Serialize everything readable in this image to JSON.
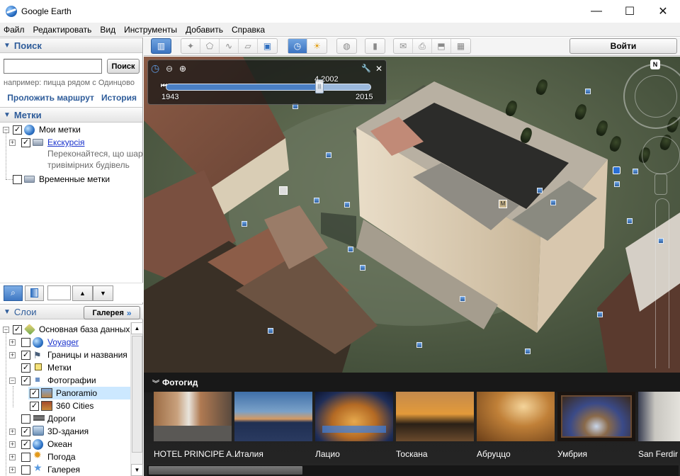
{
  "window": {
    "title": "Google Earth",
    "controls": {
      "minimize": "—",
      "maximize": "☐",
      "close": "✕"
    }
  },
  "menu": [
    "Файл",
    "Редактировать",
    "Вид",
    "Инструменты",
    "Добавить",
    "Справка"
  ],
  "search": {
    "header": "Поиск",
    "input_value": "",
    "button": "Поиск",
    "hint": "например: пицца рядом с Одинцово",
    "links": {
      "route": "Проложить маршрут",
      "history": "История"
    }
  },
  "places": {
    "header": "Метки",
    "items": [
      {
        "label": "Мои метки",
        "checked": true,
        "expanded": true,
        "icon": "globe-icon"
      },
      {
        "label": "Екскурсія",
        "checked": true,
        "expanded": false,
        "icon": "folder-icon",
        "link": true,
        "description_line1": "Переконайтеся, що шар",
        "description_line2": "тривімірних будівель"
      },
      {
        "label": "Временные метки",
        "checked": false,
        "icon": "folder-icon"
      }
    ]
  },
  "places_tools": {
    "search_icon": "⌕",
    "up_icon": "▲",
    "down_icon": "▼",
    "field_value": ""
  },
  "layers": {
    "header": "Слои",
    "gallery_button": "Галерея",
    "gallery_chevron": "»",
    "items": [
      {
        "label": "Основная база данных",
        "checked": true,
        "expanded": true,
        "icon": "layers-icon"
      },
      {
        "label": "Voyager",
        "checked": false,
        "expanded": false,
        "icon": "voyager-icon",
        "link": true
      },
      {
        "label": "Границы и названия",
        "checked": true,
        "expanded": false,
        "icon": "flag-icon"
      },
      {
        "label": "Метки",
        "checked": true,
        "icon": "placemark-icon"
      },
      {
        "label": "Фотографии",
        "checked": true,
        "expanded": true,
        "icon": "photo-icon"
      },
      {
        "label": "Panoramio",
        "checked": true,
        "icon": "panoramio-icon",
        "selected": true
      },
      {
        "label": "360 Cities",
        "checked": true,
        "icon": "cities360-icon"
      },
      {
        "label": "Дороги",
        "checked": false,
        "icon": "roads-icon"
      },
      {
        "label": "3D-здания",
        "checked": true,
        "expanded": false,
        "icon": "buildings-icon"
      },
      {
        "label": "Океан",
        "checked": true,
        "expanded": false,
        "icon": "ocean-icon"
      },
      {
        "label": "Погода",
        "checked": false,
        "expanded": false,
        "icon": "weather-icon"
      },
      {
        "label": "Галерея",
        "checked": false,
        "expanded": false,
        "icon": "gallery-star-icon"
      }
    ]
  },
  "toolbar": {
    "login": "Войти",
    "buttons": [
      {
        "name": "sidebar-toggle",
        "icon": "▥",
        "active": true
      },
      {
        "name": "add-placemark",
        "icon": "✦",
        "active": false
      },
      {
        "name": "add-polygon",
        "icon": "⬠",
        "active": false
      },
      {
        "name": "add-path",
        "icon": "∿",
        "active": false
      },
      {
        "name": "add-image-overlay",
        "icon": "▱",
        "active": false
      },
      {
        "name": "record-tour",
        "icon": "▣",
        "active": false
      },
      {
        "name": "historical-imagery",
        "icon": "◷",
        "active": true
      },
      {
        "name": "sunlight",
        "icon": "☀",
        "active": false
      },
      {
        "name": "switch-planet",
        "icon": "◍",
        "active": false
      },
      {
        "name": "ruler",
        "icon": "▮",
        "active": false
      },
      {
        "name": "email",
        "icon": "✉",
        "active": false
      },
      {
        "name": "print",
        "icon": "⎙",
        "active": false
      },
      {
        "name": "save-image",
        "icon": "⬒",
        "active": false
      },
      {
        "name": "view-in-maps",
        "icon": "▦",
        "active": false
      }
    ]
  },
  "time_slider": {
    "current_label": "4.2002",
    "start_year": "1943",
    "end_year": "2015",
    "position_fraction": 0.75,
    "icons": {
      "clock": "◷",
      "zoom_out": "⊖",
      "zoom_in": "⊕",
      "settings": "🔧",
      "close": "✕"
    }
  },
  "navigation": {
    "north_label": "N"
  },
  "photo_guide": {
    "header": "Фотогид",
    "items": [
      {
        "label": "HOTEL PRINCIPE A..."
      },
      {
        "label": "Италия"
      },
      {
        "label": "Лацио"
      },
      {
        "label": "Тоскана"
      },
      {
        "label": "Абруццо"
      },
      {
        "label": "Умбрия"
      },
      {
        "label": "San Ferdir"
      }
    ],
    "scroll_fraction": 0.29
  },
  "colors": {
    "accent_blue": "#2e5c9a",
    "link_blue": "#1a33cc",
    "selected_row": "#cce8ff",
    "toolbar_active": "#3f78c3"
  }
}
